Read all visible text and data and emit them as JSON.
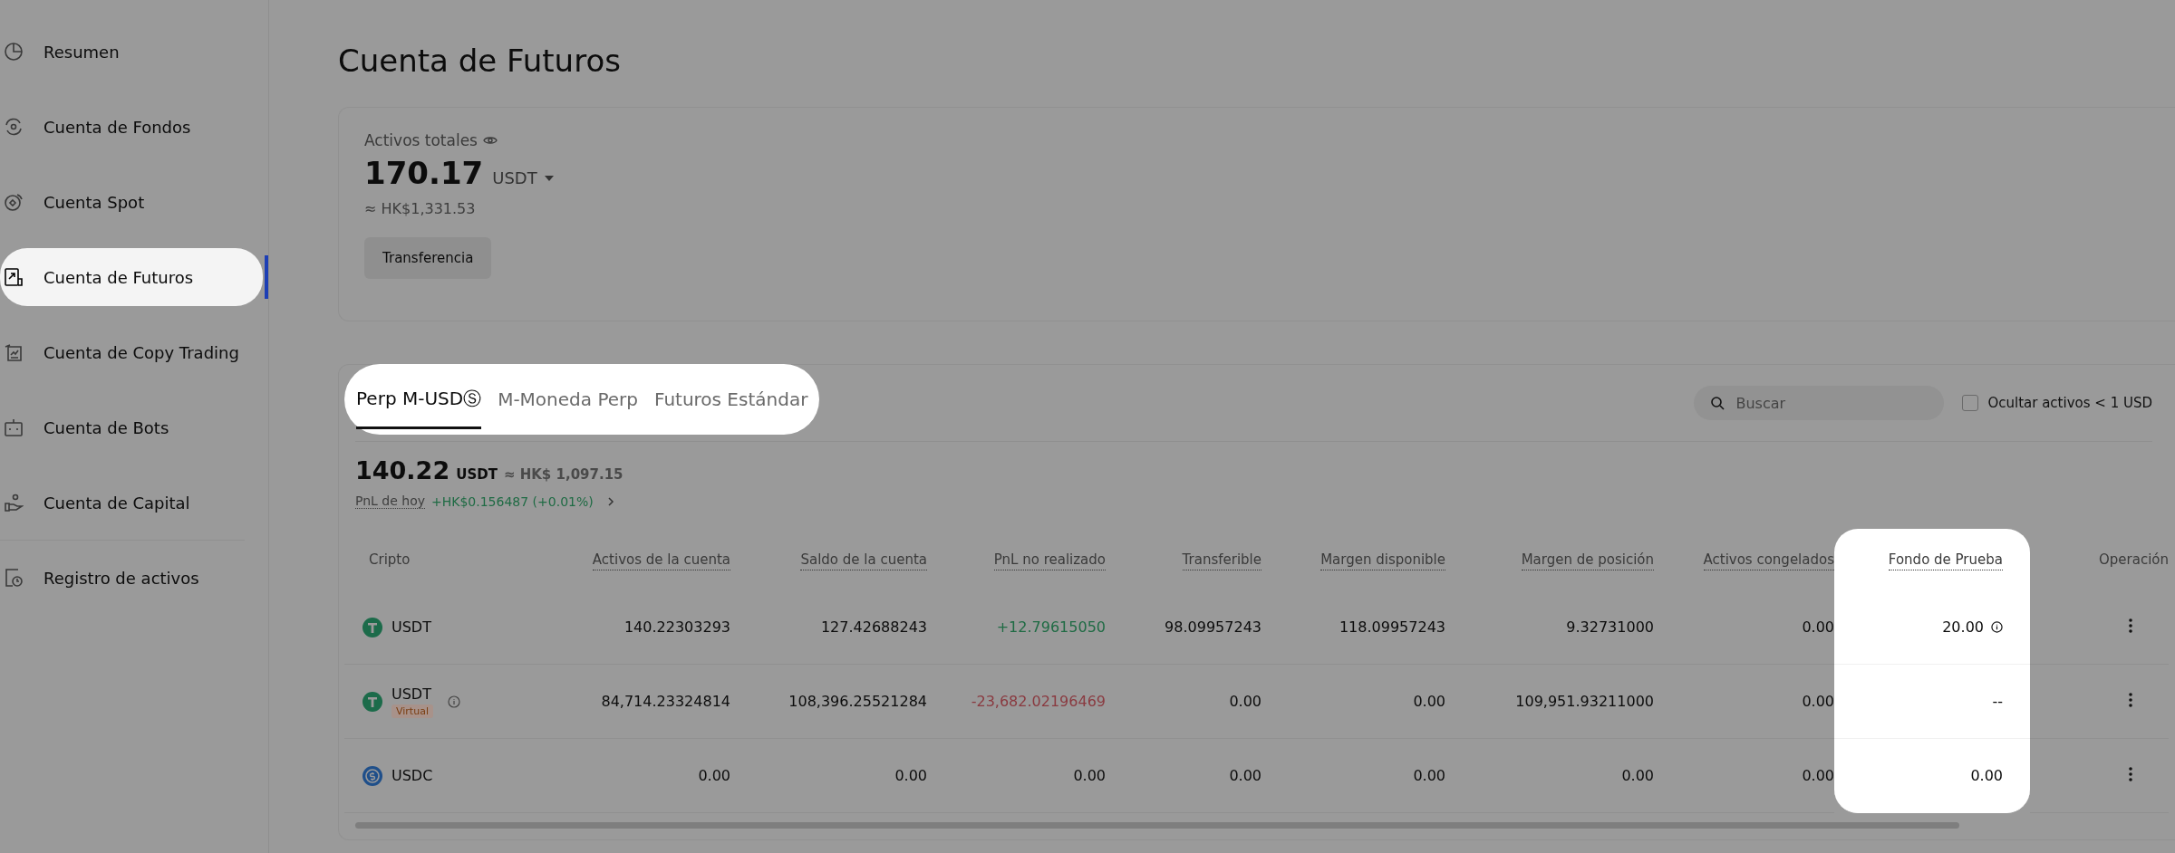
{
  "sidebar": {
    "items": [
      {
        "label": "Resumen",
        "kind": "pie",
        "selected": false
      },
      {
        "label": "Cuenta de Fondos",
        "kind": "cycle",
        "selected": false
      },
      {
        "label": "Cuenta Spot",
        "kind": "target",
        "selected": false
      },
      {
        "label": "Cuenta de Futuros",
        "kind": "futures",
        "selected": true
      },
      {
        "label": "Cuenta de Copy Trading",
        "kind": "copy",
        "selected": false
      },
      {
        "label": "Cuenta de Bots",
        "kind": "bot",
        "selected": false
      },
      {
        "label": "Cuenta de Capital",
        "kind": "hand",
        "selected": false
      },
      {
        "label": "Registro de activos",
        "kind": "clock",
        "selected": false
      }
    ]
  },
  "title": "Cuenta de Futuros",
  "summary": {
    "label": "Activos totales",
    "amount": "170.17",
    "currency": "USDT",
    "fiat": "≈ HK$1,331.53",
    "button": "Transferencia"
  },
  "tab_bar": {
    "spotlight": true,
    "tabs": [
      {
        "label": "Perp M-USDⓈ",
        "selected": true
      },
      {
        "label": "M-Moneda Perp",
        "selected": false
      },
      {
        "label": "Futuros Estándar",
        "selected": false
      }
    ]
  },
  "search": {
    "placeholder": "Buscar"
  },
  "hide_small": {
    "label": "Ocultar activos < 1 USD",
    "checked": false
  },
  "balance": {
    "amount": "140.22",
    "currency": "USDT",
    "fiat": "≈ HK$ 1,097.15"
  },
  "pnl": {
    "label": "PnL de hoy",
    "value": "+HK$0.156487 (+0.01%)"
  },
  "table": {
    "columns": [
      {
        "label": "Cripto",
        "dotted": false,
        "spotlight": false
      },
      {
        "label": "Activos de la cuenta",
        "dotted": true,
        "spotlight": false
      },
      {
        "label": "Saldo de la cuenta",
        "dotted": true,
        "spotlight": false
      },
      {
        "label": "PnL no realizado",
        "dotted": true,
        "spotlight": false
      },
      {
        "label": "Transferible",
        "dotted": true,
        "spotlight": false
      },
      {
        "label": "Margen disponible",
        "dotted": true,
        "spotlight": false
      },
      {
        "label": "Margen de posición",
        "dotted": true,
        "spotlight": false
      },
      {
        "label": "Activos congelados",
        "dotted": true,
        "spotlight": false
      },
      {
        "label": "Fondo de Prueba",
        "dotted": true,
        "spotlight": true
      },
      {
        "label": "Operación",
        "dotted": false,
        "spotlight": false
      }
    ],
    "rows": [
      {
        "coin": "USDT",
        "kind": "tether",
        "name_info": false,
        "color": "#1f6b44",
        "fund_info": true,
        "values": [
          "140.22303293",
          "127.42688243",
          "+12.79615050",
          "98.09957243",
          "118.09957243",
          "9.32731000",
          "0.00",
          "20.00"
        ]
      },
      {
        "coin": "USDT",
        "kind": "tether",
        "tag": "Virtual",
        "name_info": true,
        "color": "#8a3a40",
        "fund_info": false,
        "values": [
          "84,714.23324814",
          "108,396.25521284",
          "-23,682.02196469",
          "0.00",
          "0.00",
          "109,951.93211000",
          "0.00",
          "--"
        ]
      },
      {
        "coin": "USDC",
        "kind": "usdc",
        "name_info": false,
        "color": "#0c0c0c",
        "fund_info": false,
        "values": [
          "0.00",
          "0.00",
          "0.00",
          "0.00",
          "0.00",
          "0.00",
          "0.00",
          "0.00"
        ]
      }
    ]
  }
}
